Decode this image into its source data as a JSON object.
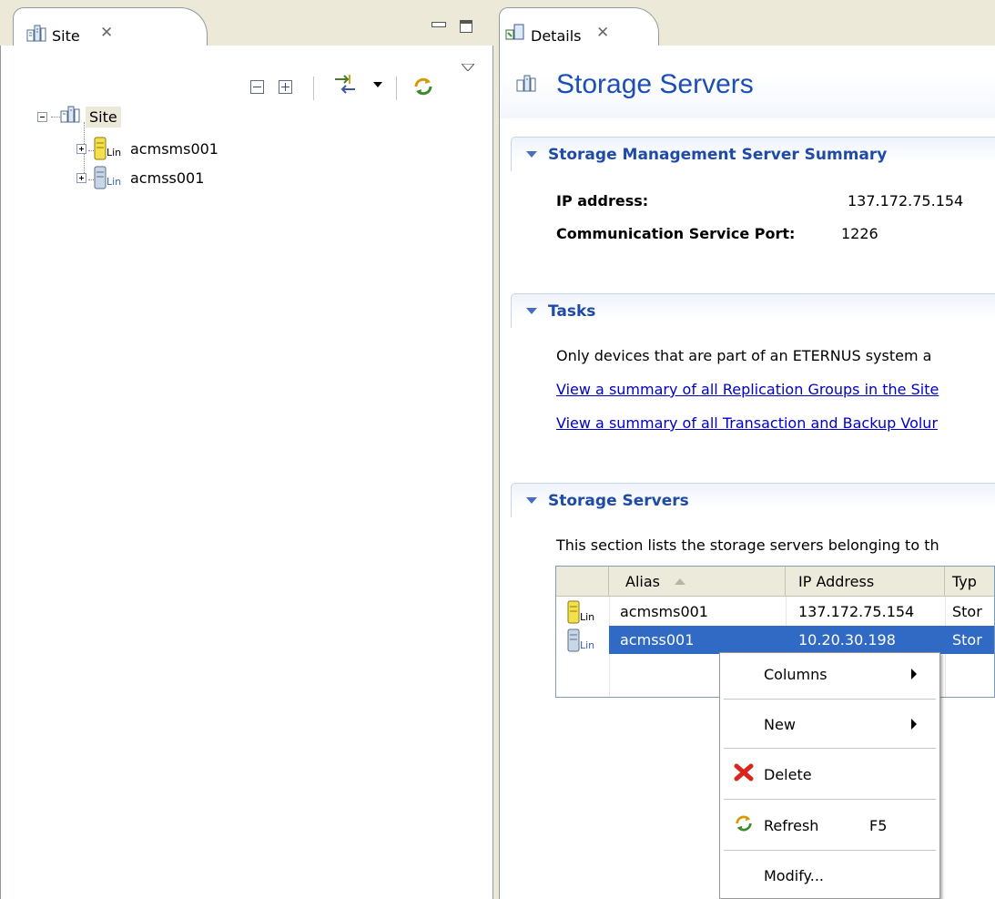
{
  "left_view": {
    "tab_label": "Site",
    "close_glyph": "✕",
    "toolbar": {
      "icons": [
        "collapse-all-icon",
        "expand-all-icon",
        "sync-with-editor-icon",
        "dropdown-arrow-icon",
        "refresh-icon",
        "view-menu-icon"
      ]
    },
    "tree": {
      "root": "Site",
      "children": [
        {
          "label": "acmsms001",
          "badge": "Lin"
        },
        {
          "label": "acmss001",
          "badge": "Lin"
        }
      ]
    }
  },
  "right_view": {
    "tab_label": "Details",
    "title": "Storage Servers",
    "sections": {
      "summary": {
        "title": "Storage Management Server Summary",
        "ip_label": "IP address:",
        "ip_value": "137.172.75.154",
        "port_label": "Communication Service Port:",
        "port_value": "1226"
      },
      "tasks": {
        "title": "Tasks",
        "note": "Only devices that are part of an ETERNUS system a",
        "links": [
          "View a summary of all Replication Groups in the Site",
          "View a summary of all Transaction and Backup Volur"
        ]
      },
      "servers": {
        "title": "Storage Servers",
        "description": "This section lists the storage servers belonging to th",
        "columns": [
          "Alias",
          "IP Address",
          "Typ"
        ],
        "rows": [
          {
            "badge": "Lin",
            "alias": "acmsms001",
            "ip": "137.172.75.154",
            "type": "Stor"
          },
          {
            "badge": "Lin",
            "alias": "acmss001",
            "ip": "10.20.30.198",
            "type": "Stor"
          }
        ]
      }
    }
  },
  "context_menu": {
    "items": [
      {
        "label": "Columns",
        "submenu": true
      },
      {
        "label": "New",
        "submenu": true
      },
      {
        "label": "Delete",
        "icon": "delete-x-icon"
      },
      {
        "label": "Refresh",
        "accel": "F5",
        "icon": "refresh-icon"
      },
      {
        "label": "Modify..."
      }
    ]
  },
  "colors": {
    "title_blue": "#1c4fb4",
    "section_blue": "#1e4ba6",
    "selection": "#316ac5",
    "link": "#0000cc",
    "chrome": "#ece9d8"
  }
}
